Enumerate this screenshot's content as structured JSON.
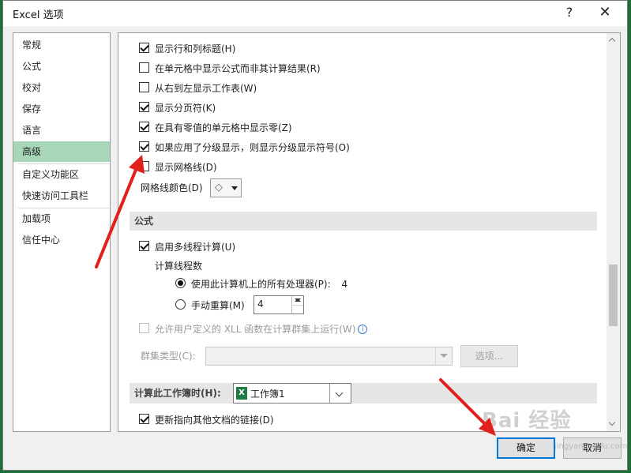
{
  "dialog": {
    "title": "Excel 选项",
    "help_glyph": "?",
    "close_glyph": "✕"
  },
  "nav": {
    "items": [
      {
        "label": "常规"
      },
      {
        "label": "公式"
      },
      {
        "label": "校对"
      },
      {
        "label": "保存"
      },
      {
        "label": "语言"
      },
      {
        "label": "高级",
        "active": true
      },
      {
        "label": "自定义功能区"
      },
      {
        "label": "快速访问工具栏"
      },
      {
        "label": "加载项"
      },
      {
        "label": "信任中心"
      }
    ]
  },
  "display": {
    "show_row_col_headers": {
      "label": "显示行和列标题(H)",
      "checked": true
    },
    "show_formulas": {
      "label": "在单元格中显示公式而非其计算结果(R)",
      "checked": false
    },
    "right_to_left": {
      "label": "从右到左显示工作表(W)",
      "checked": false
    },
    "show_page_breaks": {
      "label": "显示分页符(K)",
      "checked": true
    },
    "show_zero": {
      "label": "在具有零值的单元格中显示零(Z)",
      "checked": true
    },
    "show_outline": {
      "label": "如果应用了分级显示，则显示分级显示符号(O)",
      "checked": true
    },
    "show_gridlines": {
      "label": "显示网格线(D)",
      "checked": false
    },
    "gridline_color_label": "网格线颜色(D)"
  },
  "formulas": {
    "section_title": "公式",
    "multithread": {
      "label": "启用多线程计算(U)",
      "checked": true
    },
    "threads_label": "计算线程数",
    "use_all_processors": {
      "label": "使用此计算机上的所有处理器(P):",
      "value": "4",
      "selected": true
    },
    "manual": {
      "label": "手动重算(M)",
      "selected": false
    },
    "manual_threads_value": "4",
    "xll_cluster": {
      "label": "允许用户定义的 XLL 函数在计算群集上运行(W)",
      "checked": false
    },
    "cluster_type_label": "群集类型(C):",
    "options_button": "选项..."
  },
  "workbook_calc": {
    "section_title": "计算此工作簿时(H):",
    "workbook_value": "工作簿1",
    "update_links": {
      "label": "更新指向其他文档的链接(D)",
      "checked": true
    }
  },
  "buttons": {
    "ok": "确定",
    "cancel": "取消"
  },
  "watermark": {
    "text": "Bai 经验",
    "sub": "jingyan.baidu.com"
  },
  "colors": {
    "active_nav": "#a7d7b8",
    "accent_border": "#0078d7",
    "annotation_arrow": "#e0201b",
    "excel_green": "#1f7a44"
  }
}
